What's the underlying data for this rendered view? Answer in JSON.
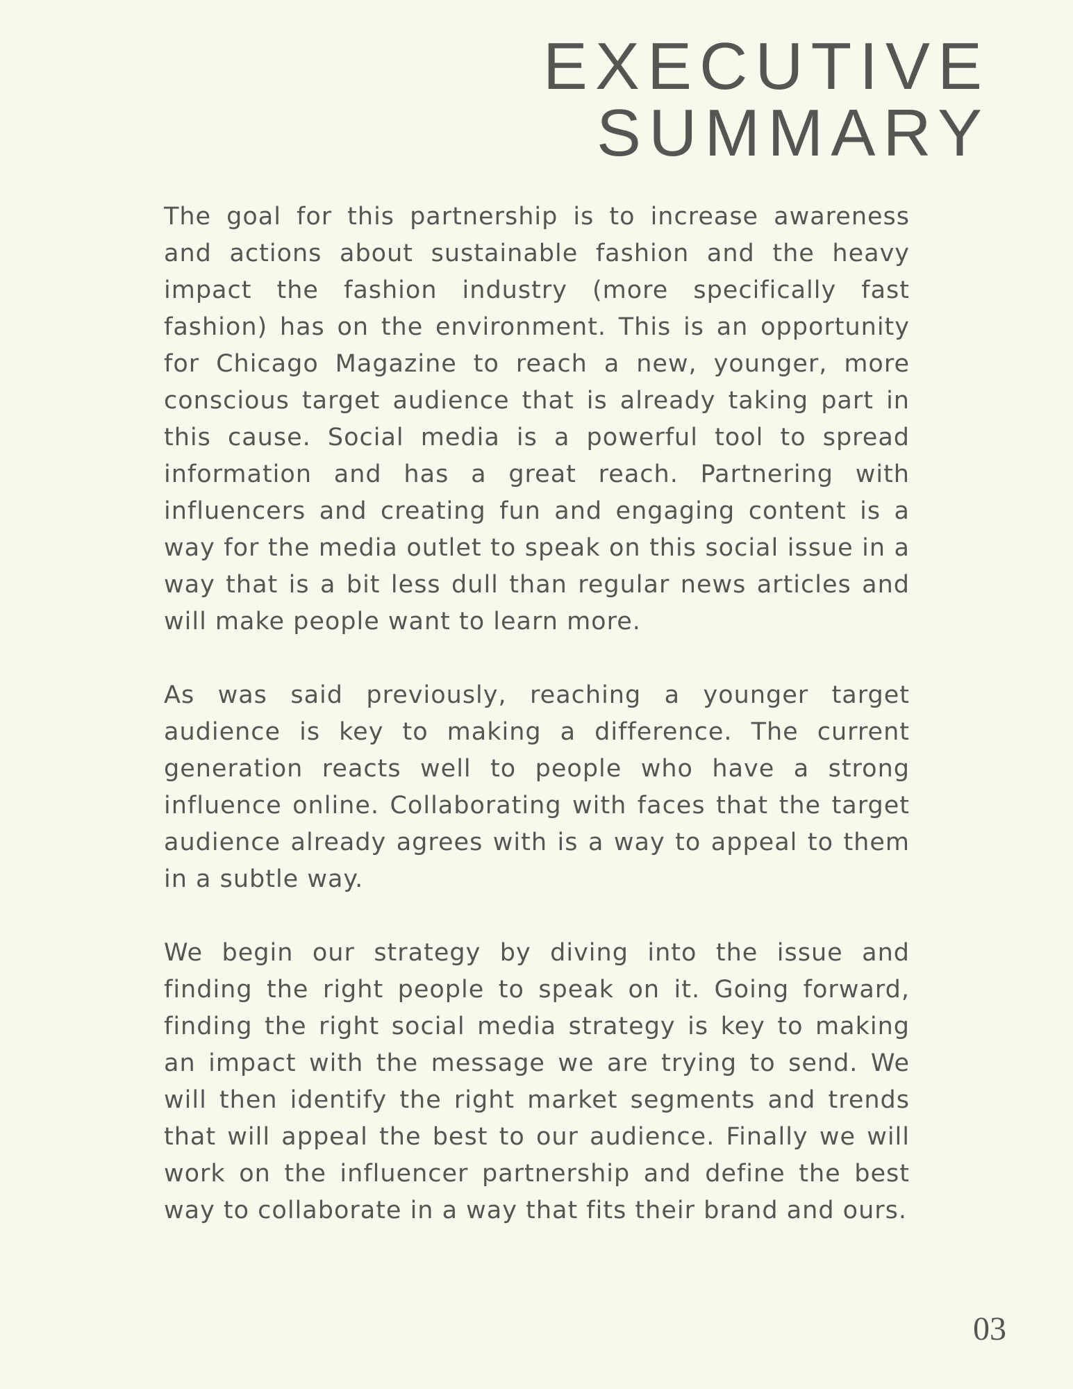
{
  "title": {
    "line1": "EXECUTIVE",
    "line2": "SUMMARY"
  },
  "paragraphs": [
    "The goal for this partnership is to increase awareness and actions about sustainable fashion and the heavy impact the fashion industry (more specifically fast fashion) has on the environment. This is an opportunity for Chicago Magazine to reach a new, younger, more conscious target audience that is already taking part in this cause. Social media is a powerful tool to spread information and has a great reach. Partnering with influencers and creating fun and engaging content is a way for the media outlet to speak on this social issue in a way that is a bit less dull than regular news articles and will make people want to learn more.",
    "As was said previously, reaching a younger target audience is key to making a difference. The current generation reacts well to people who have a strong influence online. Collaborating with faces that the target audience already agrees with is a way to appeal to them in a subtle way.",
    "We begin our strategy by diving into the issue and finding the right people to speak on it. Going forward, finding the right social media strategy is key to making an impact with the message we are trying to send. We will then identify the right market segments and trends that will appeal the best to our audience. Finally we will work on the influencer partnership and define the best way to collaborate in a way that fits their brand and ours."
  ],
  "page_number": "03",
  "colors": {
    "background": "#f8f9ec",
    "text": "#545652"
  }
}
